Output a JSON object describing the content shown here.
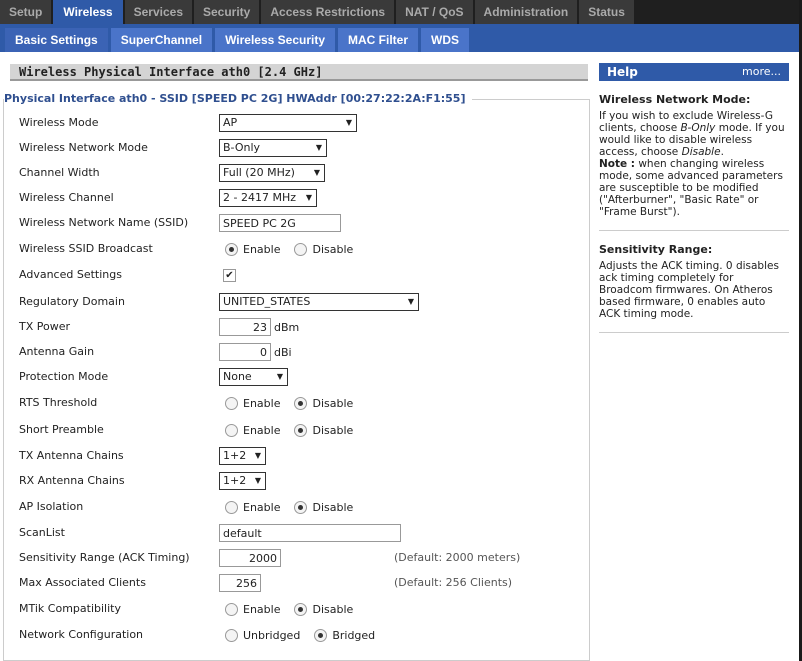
{
  "tabs": [
    "Setup",
    "Wireless",
    "Services",
    "Security",
    "Access Restrictions",
    "NAT / QoS",
    "Administration",
    "Status"
  ],
  "subtabs": [
    "Basic Settings",
    "SuperChannel",
    "Wireless Security",
    "MAC Filter",
    "WDS"
  ],
  "section_title": "Wireless Physical Interface ath0 [2.4 GHz]",
  "legend": "Physical Interface ath0 - SSID [SPEED PC 2G] HWAddr [00:27:22:2A:F1:55]",
  "fields": {
    "mode": {
      "label": "Wireless Mode",
      "value": "AP"
    },
    "netmode": {
      "label": "Wireless Network Mode",
      "value": "B-Only"
    },
    "width": {
      "label": "Channel Width",
      "value": "Full (20 MHz)"
    },
    "channel": {
      "label": "Wireless Channel",
      "value": "2 - 2417 MHz"
    },
    "ssid": {
      "label": "Wireless Network Name (SSID)",
      "value": "SPEED PC 2G"
    },
    "broadcast": {
      "label": "Wireless SSID Broadcast",
      "opt1": "Enable",
      "opt2": "Disable",
      "selected": "Enable"
    },
    "advanced": {
      "label": "Advanced Settings",
      "checked": true,
      "mark": "✔"
    },
    "regdomain": {
      "label": "Regulatory Domain",
      "value": "UNITED_STATES"
    },
    "txpower": {
      "label": "TX Power",
      "value": "23",
      "unit": "dBm"
    },
    "gain": {
      "label": "Antenna Gain",
      "value": "0",
      "unit": "dBi"
    },
    "protection": {
      "label": "Protection Mode",
      "value": "None"
    },
    "rts": {
      "label": "RTS Threshold",
      "opt1": "Enable",
      "opt2": "Disable",
      "selected": "Disable"
    },
    "preamble": {
      "label": "Short Preamble",
      "opt1": "Enable",
      "opt2": "Disable",
      "selected": "Disable"
    },
    "txchains": {
      "label": "TX Antenna Chains",
      "value": "1+2"
    },
    "rxchains": {
      "label": "RX Antenna Chains",
      "value": "1+2"
    },
    "isolation": {
      "label": "AP Isolation",
      "opt1": "Enable",
      "opt2": "Disable",
      "selected": "Disable"
    },
    "scanlist": {
      "label": "ScanList",
      "value": "default"
    },
    "sensitivity": {
      "label": "Sensitivity Range (ACK Timing)",
      "value": "2000",
      "default": "(Default: 2000 meters)"
    },
    "maxclients": {
      "label": "Max Associated Clients",
      "value": "256",
      "default": "(Default: 256 Clients)"
    },
    "mtik": {
      "label": "MTik Compatibility",
      "opt1": "Enable",
      "opt2": "Disable",
      "selected": "Disable"
    },
    "netconfig": {
      "label": "Network Configuration",
      "opt1": "Unbridged",
      "opt2": "Bridged",
      "selected": "Bridged"
    }
  },
  "help": {
    "title": "Help",
    "more": "more...",
    "h1": "Wireless Network Mode:",
    "p1a": "If you wish to exclude Wireless-G clients, choose ",
    "p1b": "B-Only",
    "p1c": " mode. If you would like to disable wireless access, choose ",
    "p1d": "Disable",
    "p1e": ".",
    "note_label": "Note :",
    "note": " when changing wireless mode, some advanced parameters are susceptible to be modified (\"Afterburner\", \"Basic Rate\" or \"Frame Burst\").",
    "h2": "Sensitivity Range:",
    "p2": "Adjusts the ACK timing. 0 disables ack timing completely for Broadcom firmwares. On Atheros based firmware, 0 enables auto ACK timing mode."
  }
}
